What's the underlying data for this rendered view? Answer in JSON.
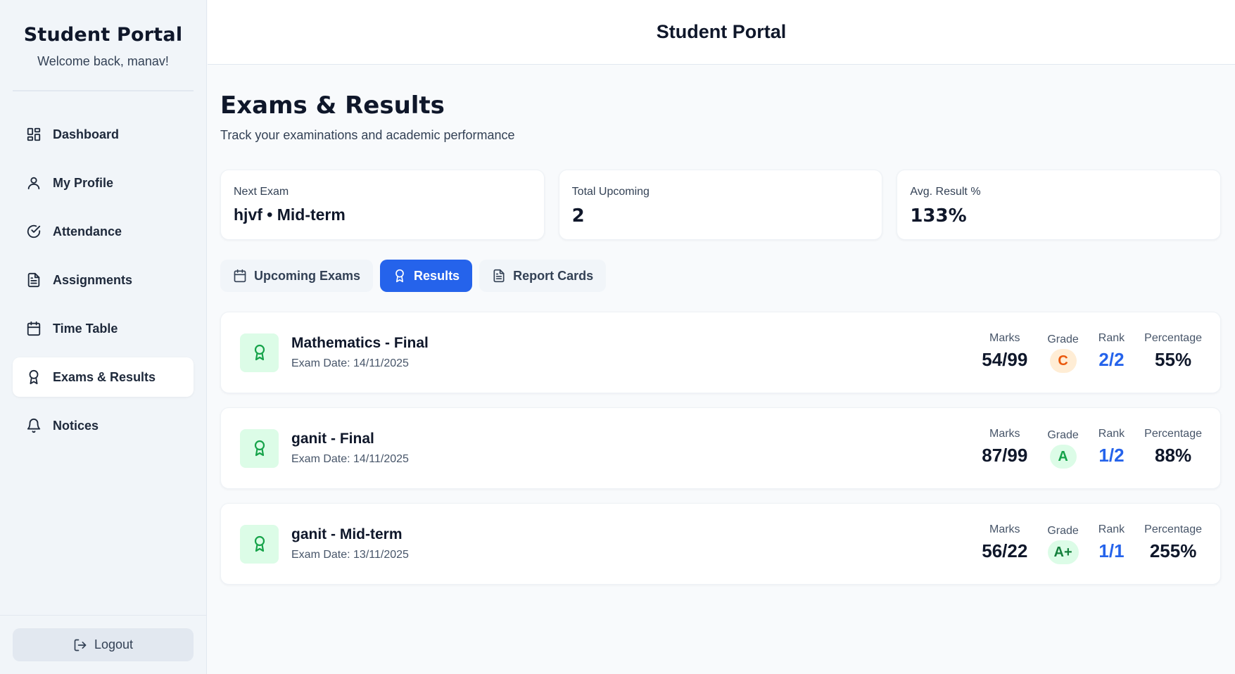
{
  "sidebar": {
    "title": "Student Portal",
    "welcome": "Welcome back, manav!",
    "items": [
      {
        "label": "Dashboard",
        "icon": "dashboard-icon"
      },
      {
        "label": "My Profile",
        "icon": "user-icon"
      },
      {
        "label": "Attendance",
        "icon": "check-circle-icon"
      },
      {
        "label": "Assignments",
        "icon": "document-icon"
      },
      {
        "label": "Time Table",
        "icon": "calendar-icon"
      },
      {
        "label": "Exams & Results",
        "icon": "award-icon",
        "active": true
      },
      {
        "label": "Notices",
        "icon": "bell-icon"
      }
    ],
    "logout_label": "Logout"
  },
  "topbar": {
    "title": "Student Portal"
  },
  "page": {
    "title": "Exams & Results",
    "subtitle": "Track your examinations and academic performance"
  },
  "stats": [
    {
      "label": "Next Exam",
      "value": "hjvf • Mid-term"
    },
    {
      "label": "Total Upcoming",
      "value": "2"
    },
    {
      "label": "Avg. Result %",
      "value": "133%"
    }
  ],
  "tabs": [
    {
      "label": "Upcoming Exams",
      "icon": "calendar-icon"
    },
    {
      "label": "Results",
      "icon": "award-icon",
      "active": true
    },
    {
      "label": "Report Cards",
      "icon": "document-icon"
    }
  ],
  "metric_labels": {
    "marks": "Marks",
    "grade": "Grade",
    "rank": "Rank",
    "percentage": "Percentage"
  },
  "results": [
    {
      "title": "Mathematics - Final",
      "date": "Exam Date: 14/11/2025",
      "marks": "54/99",
      "grade": "C",
      "grade_color": "#ea580c",
      "grade_bg": "#ffedd5",
      "rank": "2/2",
      "percentage": "55%"
    },
    {
      "title": "ganit - Final",
      "date": "Exam Date: 14/11/2025",
      "marks": "87/99",
      "grade": "A",
      "grade_color": "#16a34a",
      "grade_bg": "#dcfce7",
      "rank": "1/2",
      "percentage": "88%"
    },
    {
      "title": "ganit - Mid-term",
      "date": "Exam Date: 13/11/2025",
      "marks": "56/22",
      "grade": "A+",
      "grade_color": "#15803d",
      "grade_bg": "#dcfce7",
      "rank": "1/1",
      "percentage": "255%"
    }
  ],
  "colors": {
    "accent": "#2563eb",
    "success": "#16a34a"
  }
}
